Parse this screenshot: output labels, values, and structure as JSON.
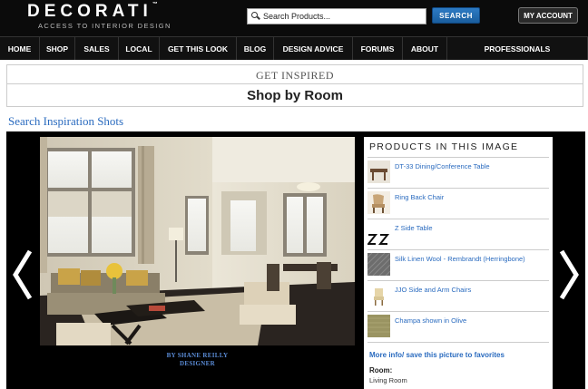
{
  "brand": {
    "logo": "DECORATI",
    "tagline": "ACCESS TO INTERIOR DESIGN"
  },
  "search": {
    "placeholder": "Search Products...",
    "button": "SEARCH"
  },
  "account": {
    "label": "MY ACCOUNT"
  },
  "nav": [
    {
      "label": "HOME",
      "width": 44
    },
    {
      "label": "SHOP",
      "width": 39
    },
    {
      "label": "SALES",
      "width": 48
    },
    {
      "label": "LOCAL",
      "width": 45
    },
    {
      "label": "GET THIS LOOK",
      "width": 85
    },
    {
      "label": "BLOG",
      "width": 41
    },
    {
      "label": "DESIGN ADVICE",
      "width": 87
    },
    {
      "label": "FORUMS",
      "width": 55
    },
    {
      "label": "ABOUT",
      "width": 49
    },
    {
      "label": "PROFESSIONALS",
      "width": 155
    }
  ],
  "inspired": {
    "heading": "GET INSPIRED",
    "title": "Shop by Room"
  },
  "search_shots": "Search Inspiration Shots",
  "photo": {
    "credit_line1": "BY SHANE REILLY",
    "credit_line2": "DESIGNER"
  },
  "products": {
    "title": "PRODUCTS IN THIS IMAGE",
    "items": [
      {
        "label": "DT-33 Dining/Conference Table",
        "icon": "table-thumbnail"
      },
      {
        "label": "Ring Back Chair",
        "icon": "chair-thumbnail"
      },
      {
        "label": "Z Side Table",
        "icon": "side-table-thumbnail"
      },
      {
        "label": "Silk Linen Wool - Rembrandt (Herringbone)",
        "icon": "fabric-thumbnail"
      },
      {
        "label": "JJO Side and Arm Chairs",
        "icon": "armchair-thumbnail"
      },
      {
        "label": "Champa shown in Olive",
        "icon": "olive-fabric-thumbnail"
      }
    ],
    "more_info": "More info/ save this picture to favorites",
    "room_label": "Room:",
    "room_value": "Living Room"
  },
  "colors": {
    "link": "#2a6bbf",
    "header_bg": "#0b0b0b",
    "search_button": "#1f6bb3"
  }
}
